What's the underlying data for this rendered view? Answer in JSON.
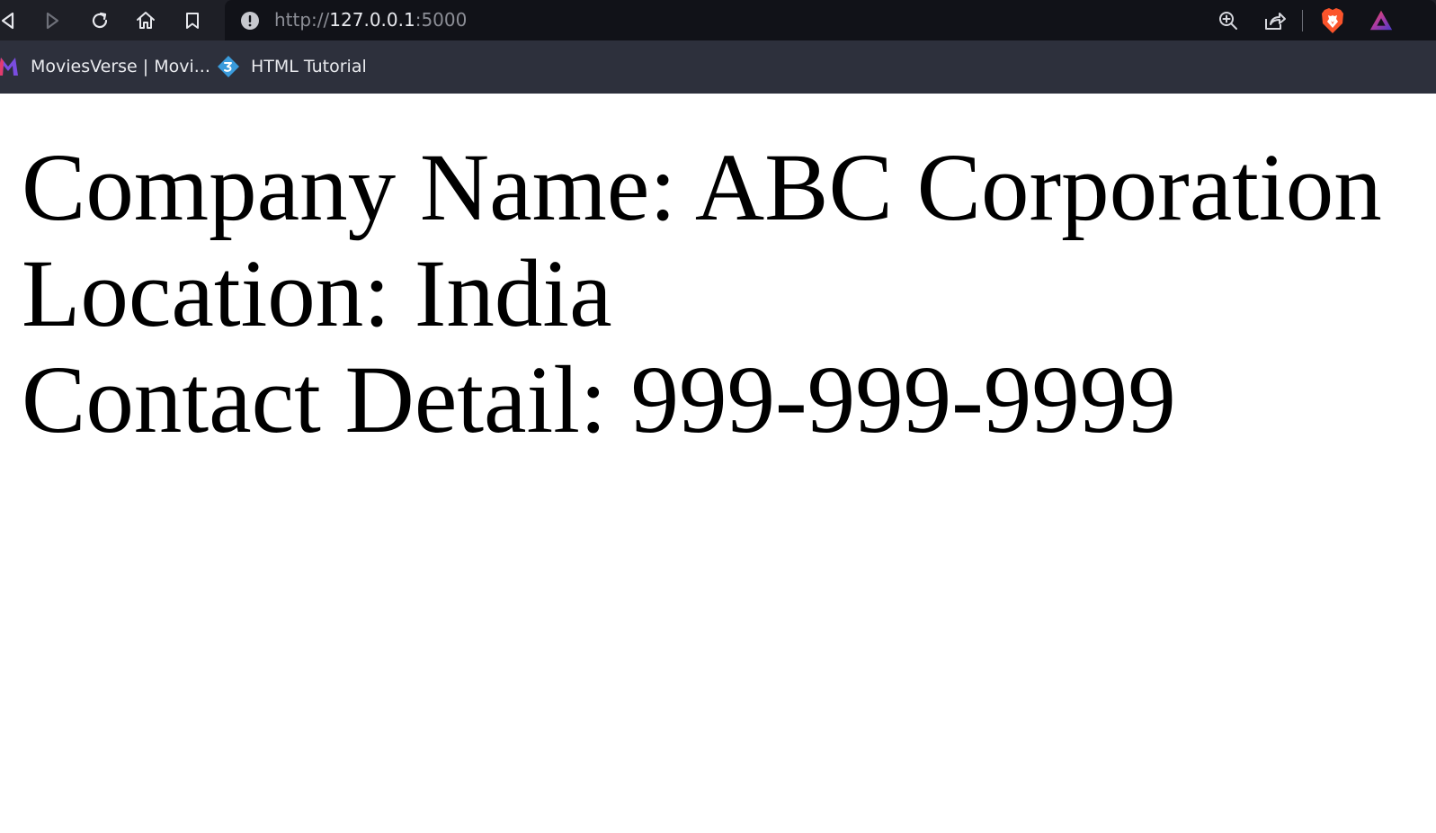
{
  "browser": {
    "url": {
      "scheme": "http://",
      "host": "127.0.0.1",
      "port": ":5000"
    },
    "nav_icons": [
      "back-icon",
      "forward-icon",
      "reload-icon",
      "home-icon",
      "bookmark-icon"
    ],
    "right_icons": [
      "zoom-icon",
      "share-icon",
      "brave-shield-icon",
      "brave-rewards-icon"
    ]
  },
  "bookmarks": [
    {
      "label": "MoviesVerse | Movi..."
    },
    {
      "label": "HTML Tutorial"
    }
  ],
  "page": {
    "company_line": "Company Name: ABC Corporation",
    "location_line": "Location: India",
    "contact_line": "Contact Detail: 999-999-9999"
  },
  "colors": {
    "toolbar_bg": "#1e1f26",
    "urlbar_bg": "#111218",
    "bookmarks_bg": "#2d303c",
    "brave_orange": "#fb542b"
  }
}
